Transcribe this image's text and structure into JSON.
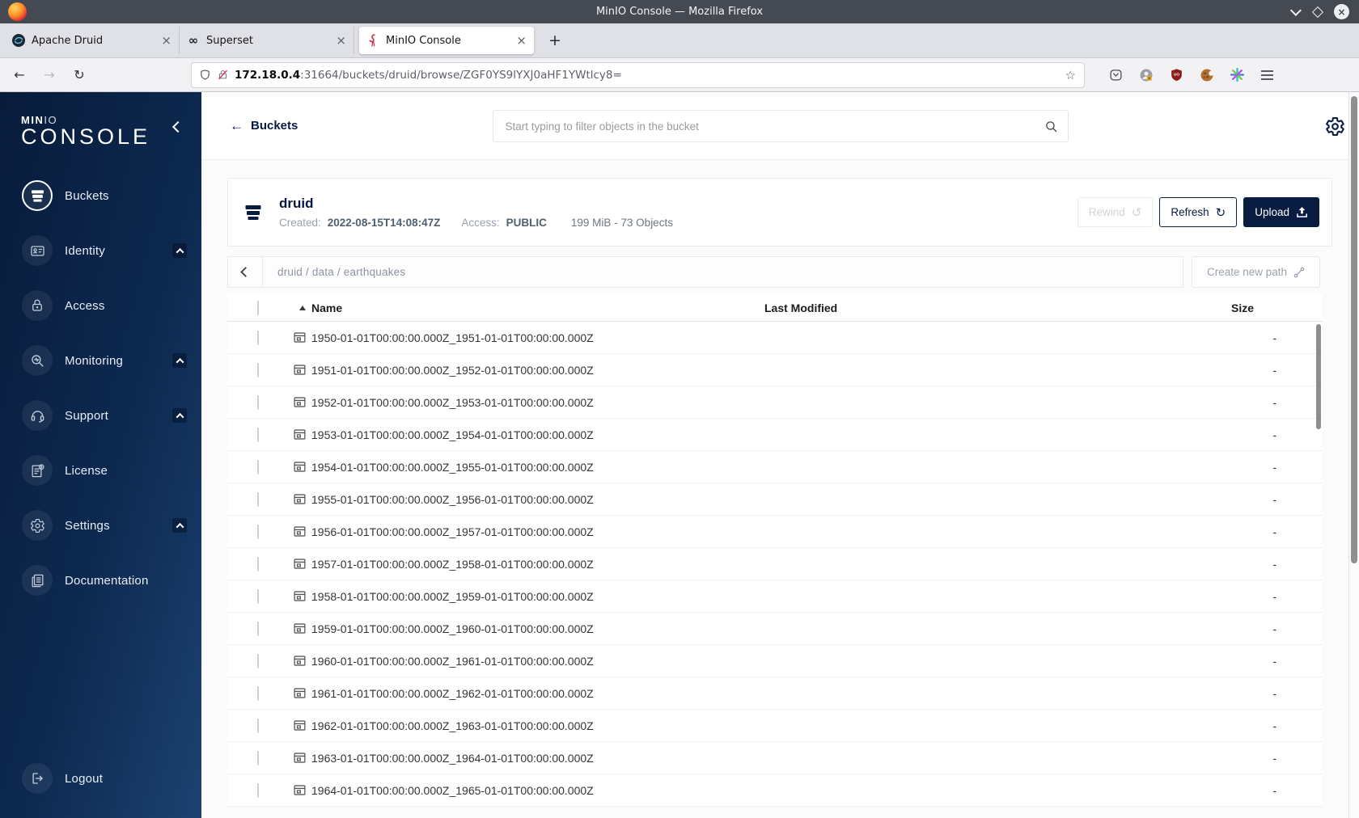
{
  "browser": {
    "window_title": "MinIO Console — Mozilla Firefox",
    "tabs": [
      {
        "label": "Apache Druid"
      },
      {
        "label": "Superset"
      },
      {
        "label": "MinIO Console"
      }
    ],
    "close_glyph": "×",
    "new_tab_glyph": "+",
    "back_glyph": "←",
    "forward_glyph": "→",
    "reload_glyph": "↻",
    "url_host": "172.18.0.4",
    "url_rest": ":31664/buckets/druid/browse/ZGF0YS9lYXJ0aHF1YWtlcy8=",
    "bookmark_star": "☆"
  },
  "sidebar": {
    "logo": {
      "bold": "MIN",
      "light": "IO",
      "line2": "CONSOLE"
    },
    "items": [
      {
        "label": "Buckets"
      },
      {
        "label": "Identity"
      },
      {
        "label": "Access"
      },
      {
        "label": "Monitoring"
      },
      {
        "label": "Support"
      },
      {
        "label": "License"
      },
      {
        "label": "Settings"
      },
      {
        "label": "Documentation"
      }
    ],
    "logout_label": "Logout"
  },
  "header": {
    "back_label": "Buckets",
    "search_placeholder": "Start typing to filter objects in the bucket"
  },
  "bucket": {
    "name": "druid",
    "created_label": "Created:",
    "created_value": "2022-08-15T14:08:47Z",
    "access_label": "Access:",
    "access_value": "PUBLIC",
    "summary": "199 MiB - 73 Objects",
    "rewind_label": "Rewind",
    "rewind_glyph": "↺",
    "refresh_label": "Refresh",
    "refresh_glyph": "↻",
    "upload_label": "Upload"
  },
  "path_bar": {
    "breadcrumb": "druid / data / earthquakes",
    "create_label": "Create new path"
  },
  "table": {
    "headers": {
      "name": "Name",
      "last_modified": "Last Modified",
      "size": "Size"
    },
    "rows": [
      {
        "name": "1950-01-01T00:00:00.000Z_1951-01-01T00:00:00.000Z",
        "size": "-"
      },
      {
        "name": "1951-01-01T00:00:00.000Z_1952-01-01T00:00:00.000Z",
        "size": "-"
      },
      {
        "name": "1952-01-01T00:00:00.000Z_1953-01-01T00:00:00.000Z",
        "size": "-"
      },
      {
        "name": "1953-01-01T00:00:00.000Z_1954-01-01T00:00:00.000Z",
        "size": "-"
      },
      {
        "name": "1954-01-01T00:00:00.000Z_1955-01-01T00:00:00.000Z",
        "size": "-"
      },
      {
        "name": "1955-01-01T00:00:00.000Z_1956-01-01T00:00:00.000Z",
        "size": "-"
      },
      {
        "name": "1956-01-01T00:00:00.000Z_1957-01-01T00:00:00.000Z",
        "size": "-"
      },
      {
        "name": "1957-01-01T00:00:00.000Z_1958-01-01T00:00:00.000Z",
        "size": "-"
      },
      {
        "name": "1958-01-01T00:00:00.000Z_1959-01-01T00:00:00.000Z",
        "size": "-"
      },
      {
        "name": "1959-01-01T00:00:00.000Z_1960-01-01T00:00:00.000Z",
        "size": "-"
      },
      {
        "name": "1960-01-01T00:00:00.000Z_1961-01-01T00:00:00.000Z",
        "size": "-"
      },
      {
        "name": "1961-01-01T00:00:00.000Z_1962-01-01T00:00:00.000Z",
        "size": "-"
      },
      {
        "name": "1962-01-01T00:00:00.000Z_1963-01-01T00:00:00.000Z",
        "size": "-"
      },
      {
        "name": "1963-01-01T00:00:00.000Z_1964-01-01T00:00:00.000Z",
        "size": "-"
      },
      {
        "name": "1964-01-01T00:00:00.000Z_1965-01-01T00:00:00.000Z",
        "size": "-"
      }
    ]
  },
  "colors": {
    "accent_navy": "#081C42",
    "minio_red": "#C72C48",
    "sidebar_gradient_start": "#081b3a",
    "sidebar_gradient_end": "#1c4270"
  }
}
